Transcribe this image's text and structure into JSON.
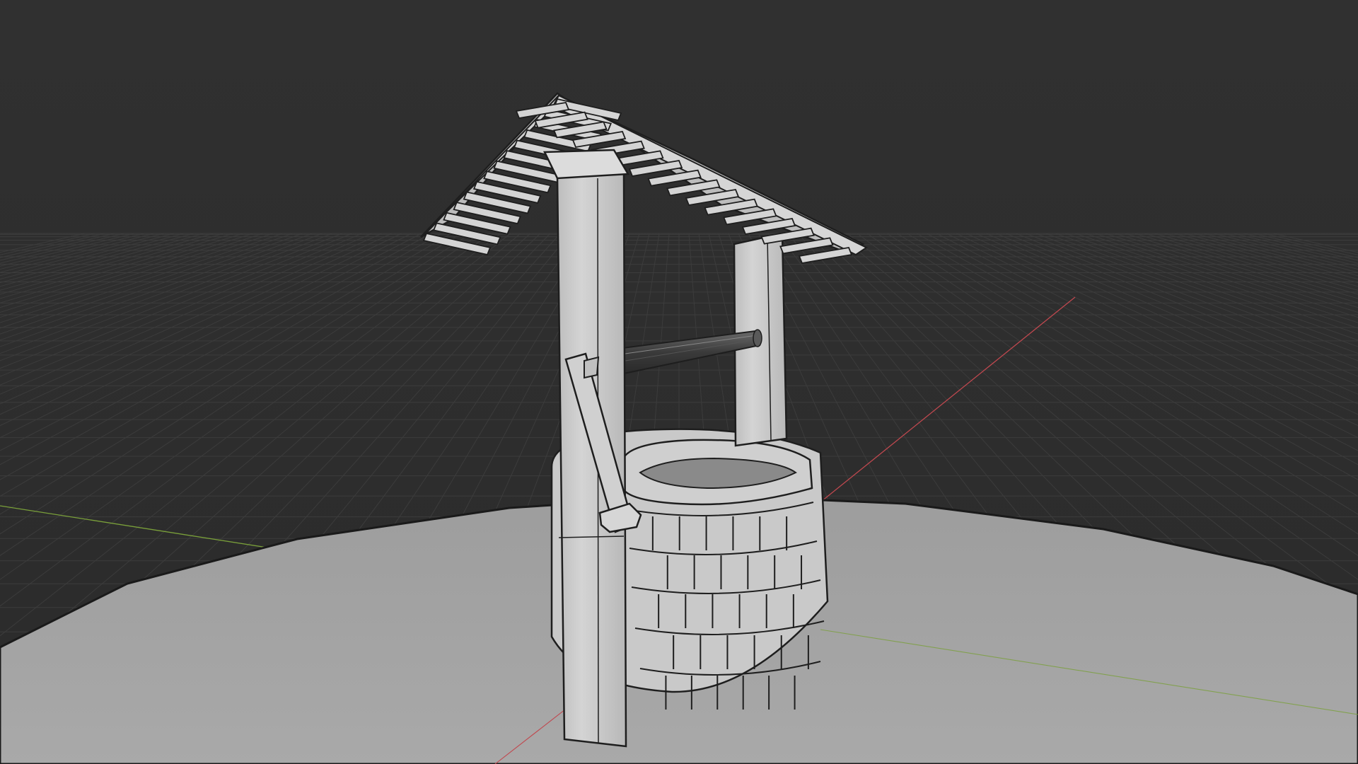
{
  "viewport": {
    "background_color": "#303030",
    "grid_color": "#3c3c3c",
    "x_axis_color": "#c0484f",
    "y_axis_color": "#7aa03a",
    "ground_color": "#a3a3a3",
    "ground_edge_color": "#1a1a1a",
    "model_color": "#cfcfcf",
    "model_shade_color": "#9b9b9b",
    "roof_color": "#cfcfcf",
    "wire_color": "#1e1e1e",
    "shaft_color": "#4a4a4a"
  },
  "scene": {
    "objects": [
      "ground-disc",
      "well-base",
      "well-post-left",
      "well-post-right",
      "well-roof",
      "well-axle",
      "well-crank"
    ]
  }
}
